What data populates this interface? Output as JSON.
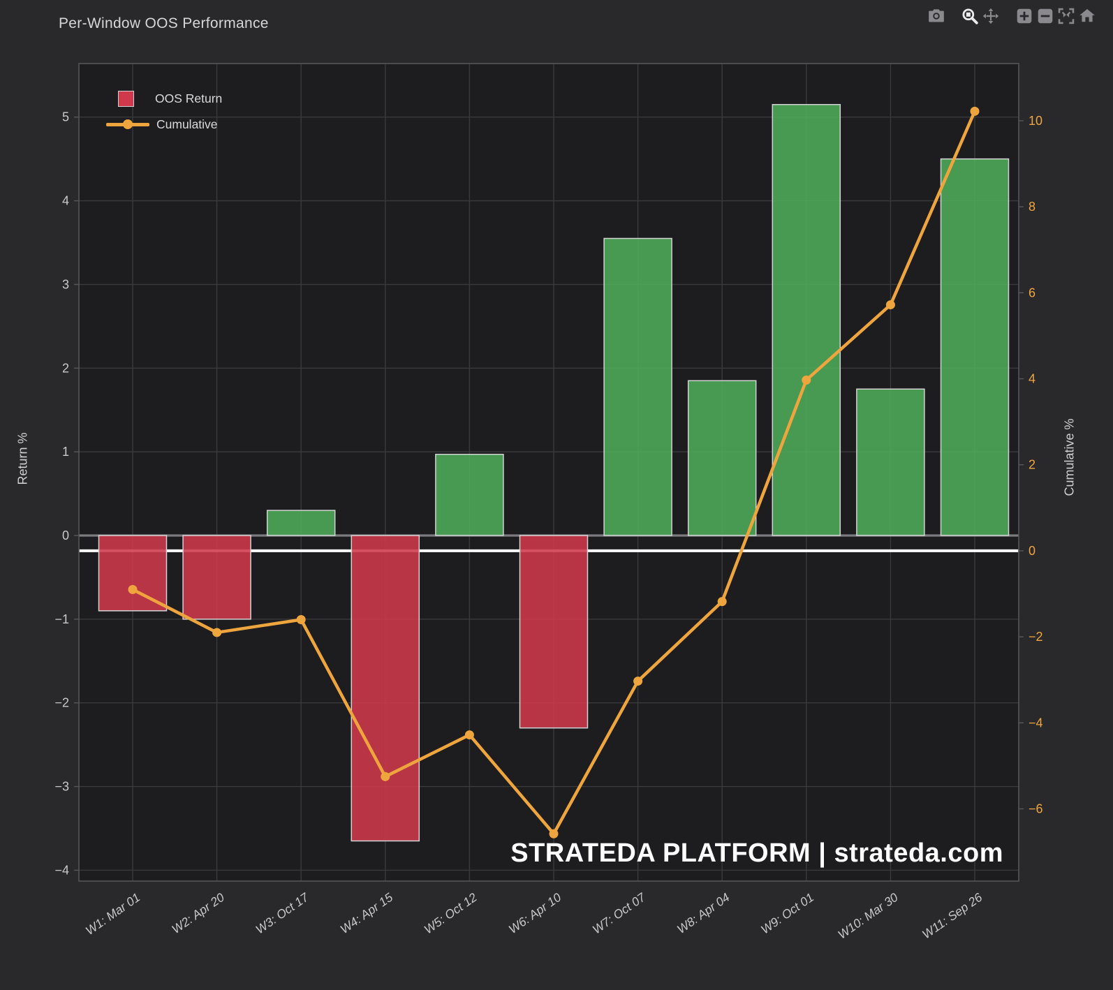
{
  "header": {
    "title": "Per-Window OOS Performance"
  },
  "modebar": {
    "tools": [
      {
        "name": "camera-icon",
        "action": "download-plot-as-png",
        "active": false
      },
      {
        "name": "zoom-icon",
        "action": "zoom",
        "active": true
      },
      {
        "name": "pan-icon",
        "action": "pan",
        "active": false
      },
      {
        "name": "zoom-in-icon",
        "action": "zoom-in",
        "active": false
      },
      {
        "name": "zoom-out-icon",
        "action": "zoom-out",
        "active": false
      },
      {
        "name": "autoscale-icon",
        "action": "autoscale",
        "active": false
      },
      {
        "name": "home-icon",
        "action": "reset-axes",
        "active": false
      }
    ]
  },
  "legend": {
    "items": [
      {
        "label": "OOS Return",
        "type": "bar"
      },
      {
        "label": "Cumulative",
        "type": "line"
      }
    ]
  },
  "watermark": "STRATEDA PLATFORM | strateda.com",
  "colors": {
    "paper": "#29292B",
    "plot_bg": "#1D1D1F",
    "grid": "#3A3A3D",
    "axis_line": "#55555A",
    "zero_line_left": "#7C7C80",
    "zero_line_right": "#FFFFFF",
    "bar_positive": "#4EAC5A",
    "bar_negative": "#CE394B",
    "bar_border": "#D3D3D5",
    "line": "#EFA53E",
    "title_text": "#D6D6D6",
    "tick_text": "#C9C9C9",
    "right_tick_text": "#F0A63E",
    "axis_title_text": "#CFCFCF",
    "legend_text": "#DADADA",
    "watermark_text": "#FFFFFF",
    "modebar_icon": "#8A8A8E",
    "modebar_icon_active": "#EBEBEB"
  },
  "chart_data": {
    "type": "bar",
    "title": "Per-Window OOS Performance",
    "categories": [
      "W1: Mar 01",
      "W2: Apr 20",
      "W3: Oct 17",
      "W4: Apr 15",
      "W5: Oct 12",
      "W6: Apr 10",
      "W7: Oct 07",
      "W8: Apr 04",
      "W9: Oct 01",
      "W10: Mar 30",
      "W11: Sep 26"
    ],
    "series": [
      {
        "name": "OOS Return",
        "type": "bar",
        "axis": "left",
        "values": [
          -0.9,
          -1.0,
          0.3,
          -3.65,
          0.97,
          -2.3,
          3.55,
          1.85,
          5.15,
          1.75,
          4.5
        ]
      },
      {
        "name": "Cumulative",
        "type": "line",
        "axis": "right",
        "values": [
          -0.9,
          -1.9,
          -1.6,
          -5.25,
          -4.28,
          -6.58,
          -3.03,
          -1.18,
          3.97,
          5.72,
          10.22
        ]
      }
    ],
    "left_axis": {
      "title": "Return %",
      "ticks": [
        5,
        4,
        3,
        2,
        1,
        0,
        -1,
        -2,
        -3,
        -4
      ],
      "range": [
        -4.13,
        5.64
      ],
      "grid": true,
      "zeroline": true
    },
    "right_axis": {
      "title": "Cumulative %",
      "ticks": [
        10,
        8,
        6,
        4,
        2,
        0,
        -2,
        -4,
        -6
      ],
      "range": [
        -7.68,
        11.33
      ],
      "grid": false,
      "zeroline": true
    },
    "x_axis": {
      "tick_angle": -35,
      "grid": true
    },
    "legend_position": "top-left"
  }
}
